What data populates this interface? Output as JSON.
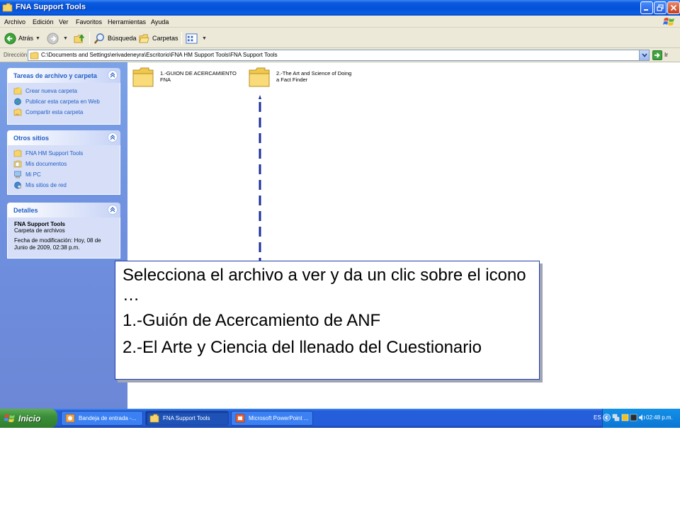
{
  "window": {
    "title": "FNA Support Tools",
    "controls": [
      "minimize",
      "maximize",
      "close"
    ]
  },
  "menubar": {
    "items": [
      "Archivo",
      "Edición",
      "Ver",
      "Favoritos",
      "Herramientas",
      "Ayuda"
    ]
  },
  "toolbar": {
    "back_label": "Atrás",
    "search_label": "Búsqueda",
    "folders_label": "Carpetas"
  },
  "address": {
    "label": "Dirección",
    "path": "C:\\Documents and Settings\\erivadeneyra\\Escritorio\\FNA HM Support Tools\\FNA Support Tools",
    "go_label": "Ir"
  },
  "sidebar": {
    "file_tasks": {
      "title": "Tareas de archivo y carpeta",
      "items": [
        "Crear nueva carpeta",
        "Publicar esta carpeta en Web",
        "Compartir esta carpeta"
      ]
    },
    "other_places": {
      "title": "Otros sitios",
      "items": [
        "FNA HM Support Tools",
        "Mis documentos",
        "Mi PC",
        "Mis sitios de red"
      ]
    },
    "details": {
      "title": "Detalles",
      "name": "FNA Support Tools",
      "type": "Carpeta de archivos",
      "modified_line1": "Fecha de modificación: Hoy, 08 de",
      "modified_line2": "Junio de 2009, 02:38 p.m."
    }
  },
  "folders": [
    {
      "line1": "1.-GUION DE ACERCAMIENTO",
      "line2": "FNA"
    },
    {
      "line1": "2.-The Art and Science of Doing",
      "line2": "a Fact Finder"
    }
  ],
  "callout": {
    "instruction": "Selecciona el archivo a ver y da un clic sobre el icono …",
    "option1": "1.-Guión de Acercamiento de ANF",
    "option2": "2.-El Arte y Ciencia del llenado del Cuestionario"
  },
  "taskbar": {
    "start_label": "Inicio",
    "tasks": [
      "Bandeja de entrada -...",
      "FNA Support Tools",
      "Microsoft PowerPoint ..."
    ],
    "language": "ES",
    "clock": "02:48 p.m."
  },
  "colors": {
    "title_bar": "#0351d6",
    "task_pane": "#6e8fdf",
    "link": "#215dc6",
    "callout_border": "#1f3da8",
    "pointer_line": "#1a2f9c",
    "start_button": "#3c8f3a"
  }
}
